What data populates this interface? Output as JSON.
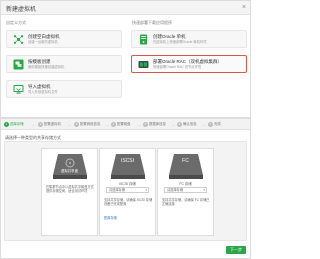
{
  "dialog": {
    "title": "新建虚拟机",
    "left_section_label": "自定义方式",
    "right_section_label": "快速部署下载应用程序",
    "cards": [
      {
        "name": "创建空白虚拟机",
        "desc": "创建一台新的虚拟机",
        "icon": "blank-vm-icon"
      },
      {
        "name": "创建Oracle 单机",
        "desc": "在虚拟机上快速部署Oracle 单机环境",
        "icon": "oracle-single-icon"
      },
      {
        "name": "按模板创建",
        "desc": "使用模板快速创建虚拟机",
        "icon": "template-icon"
      },
      {
        "name": "部署Oracle RAC（双机虚拟集群）",
        "desc": "快速部署Oracle RAC 双节点环境",
        "icon": "oracle-rac-icon",
        "selected": true
      },
      {
        "name": "导入虚拟机",
        "desc": "导入外部虚拟机文件",
        "icon": "import-vm-icon"
      }
    ]
  },
  "wizard": {
    "steps": [
      {
        "num": "1",
        "label": "选择存储",
        "active": true
      },
      {
        "num": "2",
        "label": "配置虚拟机"
      },
      {
        "num": "3",
        "label": "配置网络信息"
      },
      {
        "num": "4",
        "label": "配置磁盘"
      },
      {
        "num": "5",
        "label": "数据库信息"
      },
      {
        "num": "6",
        "label": "确认信息"
      },
      {
        "num": "7",
        "label": "完成"
      }
    ],
    "subhead": "请选择一种类型的共享存储方式",
    "options": [
      {
        "badge": "虚拟共享盘",
        "under": "",
        "field": "",
        "desc": "在集群节点中以虚拟共享磁盘方式提供存储空间，适合测试环境",
        "link": ""
      },
      {
        "badge": "ISCSI",
        "under": "ISCSI 存储",
        "field": "请选择存储",
        "desc": "支持共享存储，请确保 iSCSI 存储设备已完成配置",
        "link": "配置存储"
      },
      {
        "badge": "FC",
        "under": "FC 存储",
        "field": "请选择存储",
        "desc": "支持共享存储，请确保 FC 存储已正确连接",
        "link": ""
      }
    ],
    "next_label": "下一步",
    "accent": "#2aa748",
    "select_border": "#d9534f"
  }
}
